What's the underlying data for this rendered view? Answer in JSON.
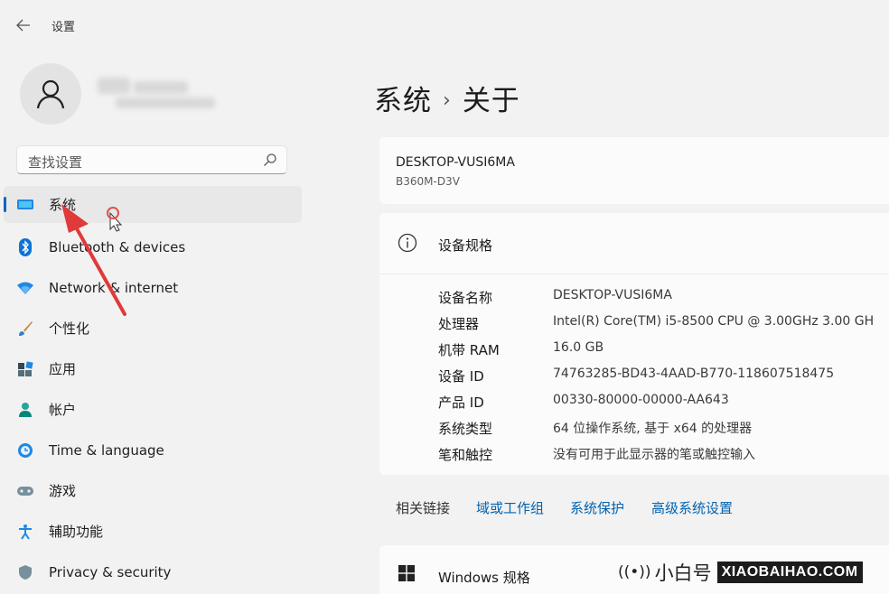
{
  "window": {
    "title": "设置"
  },
  "search": {
    "placeholder": "查找设置"
  },
  "nav": [
    {
      "label": "系统",
      "icon": "monitor-icon",
      "active": true
    },
    {
      "label": "Bluetooth & devices",
      "icon": "bluetooth-icon"
    },
    {
      "label": "Network & internet",
      "icon": "wifi-icon"
    },
    {
      "label": "个性化",
      "icon": "brush-icon"
    },
    {
      "label": "应用",
      "icon": "apps-icon"
    },
    {
      "label": "帐户",
      "icon": "person-icon"
    },
    {
      "label": "Time & language",
      "icon": "globe-clock-icon"
    },
    {
      "label": "游戏",
      "icon": "gamepad-icon"
    },
    {
      "label": "辅助功能",
      "icon": "accessibility-icon"
    },
    {
      "label": "Privacy & security",
      "icon": "shield-icon"
    }
  ],
  "breadcrumb": {
    "parent": "系统",
    "separator": "›",
    "current": "关于"
  },
  "device": {
    "name": "DESKTOP-VUSI6MA",
    "model": "B360M-D3V"
  },
  "specs": {
    "title": "设备规格",
    "rows": [
      {
        "key": "设备名称",
        "value": "DESKTOP-VUSI6MA"
      },
      {
        "key": "处理器",
        "value": "Intel(R) Core(TM) i5-8500 CPU @ 3.00GHz   3.00 GH"
      },
      {
        "key": "机带 RAM",
        "value": "16.0 GB"
      },
      {
        "key": "设备 ID",
        "value": "74763285-BD43-4AAD-B770-118607518475"
      },
      {
        "key": "产品 ID",
        "value": "00330-80000-00000-AA643"
      },
      {
        "key": "系统类型",
        "value": "64 位操作系统, 基于 x64 的处理器"
      },
      {
        "key": "笔和触控",
        "value": "没有可用于此显示器的笔或触控输入"
      }
    ]
  },
  "related_links": {
    "label": "相关链接",
    "links": [
      "域或工作组",
      "系统保护",
      "高级系统设置"
    ]
  },
  "windows_specs": {
    "title": "Windows 规格"
  },
  "watermark": {
    "brand_cn": "小白号",
    "brand_latin": "XIAOBAIHAO.COM"
  },
  "colors": {
    "accent": "#0067c0",
    "link": "#0063b1",
    "annotation_arrow": "#e03a3a"
  }
}
